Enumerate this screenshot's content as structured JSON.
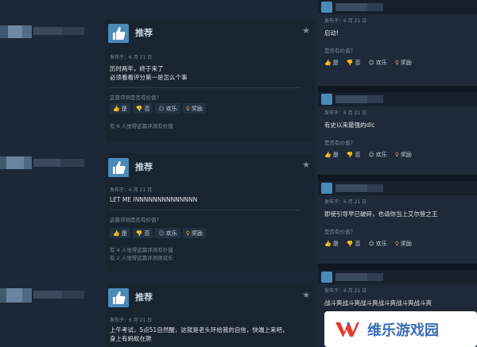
{
  "reviews": [
    {
      "rec_label": "推荐",
      "posted": "发布于：6 月 21 日",
      "lines": [
        "历时两年，终于来了",
        "必须看看评分第一是怎么个事"
      ],
      "helpful_q": "这篇评测是否有价值？",
      "votes": {
        "yes": "是",
        "no": "否",
        "funny": "欢乐",
        "award": "奖励"
      },
      "counts": [
        "有 6 人觉得这篇评测有价值"
      ]
    },
    {
      "rec_label": "推荐",
      "posted": "发布于：6 月 21 日",
      "lines": [
        "LET ME INNNNNNNNNNNNNN"
      ],
      "helpful_q": "这篇评测是否有价值？",
      "votes": {
        "yes": "是",
        "no": "否",
        "funny": "欢乐",
        "award": "奖励"
      },
      "counts": [
        "有 4 人觉得这篇评测有价值",
        "有 2 人觉得这篇评测很欢乐"
      ]
    },
    {
      "rec_label": "推荐",
      "posted": "发布于：6 月 21 日",
      "lines": [
        "上午考试，5点51自然醒，这就是老头环给我的自信，快端上来吧，",
        "身上有蚂蚁在爬"
      ]
    }
  ],
  "comments": [
    {
      "posted": "发布于：6 月 21 日",
      "text": "启动!",
      "helpful_q": "是否有价值？",
      "votes": {
        "yes": "是",
        "no": "否",
        "funny": "欢乐",
        "award": "奖励"
      }
    },
    {
      "posted": "发布于：6 月 21 日",
      "text": "有史以来最强的dlc",
      "helpful_q": "是否有价值？",
      "votes": {
        "yes": "是",
        "no": "否",
        "funny": "欢乐",
        "award": "奖励"
      }
    },
    {
      "posted": "发布于：6 月 21 日",
      "text": "即使引导早已破碎，也请你当上艾尔登之王",
      "helpful_q": "是否有价值？",
      "votes": {
        "yes": "是",
        "no": "否",
        "funny": "欢乐",
        "award": "奖励"
      }
    },
    {
      "posted": "发布于：6 月 21 日",
      "text": "战斗爽战斗爽战斗爽战斗爽战斗爽战斗爽"
    }
  ],
  "watermark": {
    "text": "维乐游戏园"
  },
  "colors": {
    "accent": "#4c8ab8",
    "bg": "#1b2838",
    "award": "#d6b04a",
    "watermark_text": "#3b6fb6",
    "watermark_red": "#e23b2e"
  }
}
